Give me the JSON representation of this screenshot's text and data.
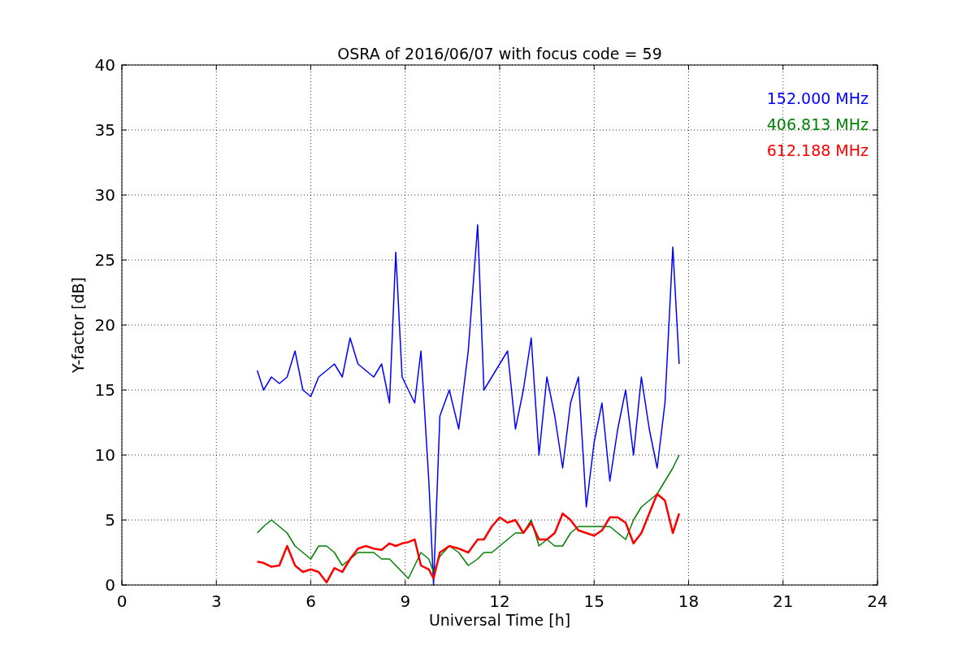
{
  "chart": {
    "chart_data": {
      "type": "line",
      "title": "OSRA of 2016/06/07 with focus code = 59",
      "xlabel": "Universal Time [h]",
      "ylabel": "Y-factor [dB]",
      "x": [
        4.3,
        4.5,
        4.75,
        5,
        5.25,
        5.5,
        5.75,
        6,
        6.25,
        6.5,
        6.75,
        7,
        7.25,
        7.5,
        7.75,
        8,
        8.25,
        8.5,
        8.7,
        8.9,
        9.1,
        9.3,
        9.5,
        9.75,
        9.9,
        10.1,
        10.4,
        10.7,
        11,
        11.3,
        11.5,
        11.75,
        12,
        12.25,
        12.5,
        12.75,
        13,
        13.25,
        13.5,
        13.75,
        14,
        14.25,
        14.5,
        14.75,
        15,
        15.25,
        15.5,
        15.75,
        16,
        16.25,
        16.5,
        16.75,
        17,
        17.25,
        17.5,
        17.7
      ],
      "series": [
        {
          "name": "152.000 MHz",
          "color": "#0000ff",
          "values": [
            16.5,
            15,
            16,
            15.5,
            16,
            18,
            15,
            14.5,
            16,
            16.5,
            17,
            16,
            19,
            17,
            16.5,
            16,
            17,
            14,
            25.6,
            16,
            15,
            14,
            18,
            8,
            0,
            13,
            15,
            12,
            18,
            27.7,
            15,
            16,
            17,
            18,
            12,
            15,
            19,
            10,
            16,
            13,
            9,
            14,
            16,
            6,
            11,
            14,
            8,
            12,
            15,
            10,
            16,
            12,
            9,
            14,
            26,
            17
          ]
        },
        {
          "name": "406.813 MHz",
          "color": "#008000",
          "values": [
            4,
            4.5,
            5,
            4.5,
            4,
            3,
            2.5,
            2,
            3,
            3,
            2.5,
            1.5,
            2,
            2.5,
            2.5,
            2.5,
            2,
            2,
            1.5,
            1,
            0.5,
            1.5,
            2.5,
            2,
            1,
            2.2,
            3,
            2.5,
            1.5,
            2,
            2.5,
            2.5,
            3,
            3.5,
            4,
            4,
            5,
            3,
            3.5,
            3,
            3,
            4,
            4.5,
            4.5,
            4.5,
            4.5,
            4.5,
            4,
            3.5,
            5,
            6,
            6.5,
            7,
            8,
            9,
            10
          ]
        },
        {
          "name": "612.188 MHz",
          "color": "#ff0000",
          "values": [
            1.8,
            1.7,
            1.4,
            1.5,
            3,
            1.5,
            1,
            1.2,
            1,
            0.2,
            1.3,
            1,
            2,
            2.8,
            3,
            2.8,
            2.7,
            3.2,
            3,
            3.2,
            3.3,
            3.5,
            1.5,
            1.2,
            0.5,
            2.5,
            3,
            2.8,
            2.5,
            3.5,
            3.5,
            4.5,
            5.2,
            4.8,
            5,
            4,
            4.8,
            3.5,
            3.5,
            4,
            5.5,
            5,
            4.2,
            4,
            3.8,
            4.2,
            5.2,
            5.2,
            4.8,
            3.2,
            4,
            5.5,
            7,
            6.5,
            4,
            5.5
          ]
        }
      ],
      "grid": true,
      "xlim": [
        0,
        24
      ],
      "ylim": [
        0,
        40
      ],
      "xticks": [
        0,
        3,
        6,
        9,
        12,
        15,
        18,
        21,
        24
      ],
      "yticks": [
        0,
        5,
        10,
        15,
        20,
        25,
        30,
        35,
        40
      ]
    }
  }
}
